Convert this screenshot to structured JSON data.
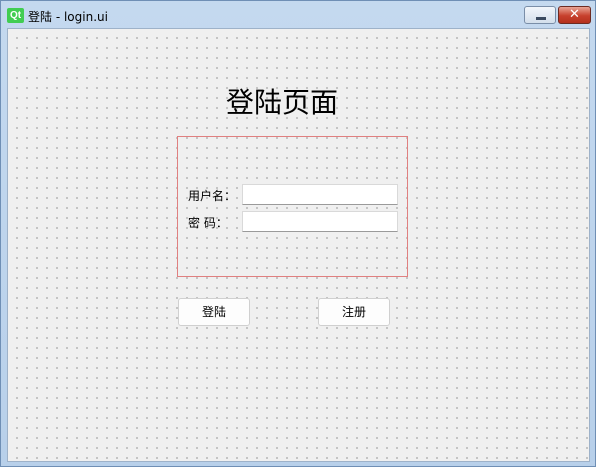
{
  "window": {
    "logo_text": "Qt",
    "title": "登陆 - login.ui",
    "close_glyph": "✕"
  },
  "page": {
    "title": "登陆页面"
  },
  "form": {
    "username_label": "用户名：",
    "username_value": "",
    "password_label": "密    码：",
    "password_value": ""
  },
  "buttons": {
    "login_label": "登陆",
    "register_label": "注册"
  },
  "colors": {
    "qt_logo": "#41cd52",
    "frame_border": "#e08080",
    "close_button": "#c7402d"
  }
}
